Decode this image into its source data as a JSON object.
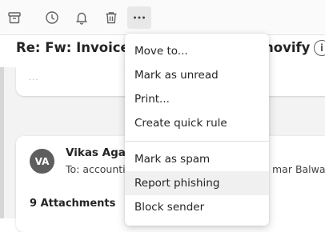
{
  "toolbar": {
    "icons": [
      "archive-icon",
      "clock-icon",
      "bell-icon",
      "trash-icon",
      "more-icon"
    ],
    "more_label": "•••"
  },
  "message": {
    "subject": "Re: Fw: Invoice",
    "subject_tail": "novify",
    "info_glyph": "i",
    "top_card_dots": "...",
    "avatar_initials": "VA",
    "sender": "Vikas Agarw",
    "to_line": "To: accountin",
    "to_tail": "mar Balwani",
    "attachments": "9 Attachments"
  },
  "menu": {
    "items": [
      "Move to...",
      "Mark as unread",
      "Print...",
      "Create quick rule",
      "Mark as spam",
      "Report phishing",
      "Block sender"
    ],
    "hovered": "Report phishing"
  },
  "colors": {
    "accent": "#242424",
    "avatar": "#5e5e5e",
    "menu_hover": "#f0f0f0"
  }
}
